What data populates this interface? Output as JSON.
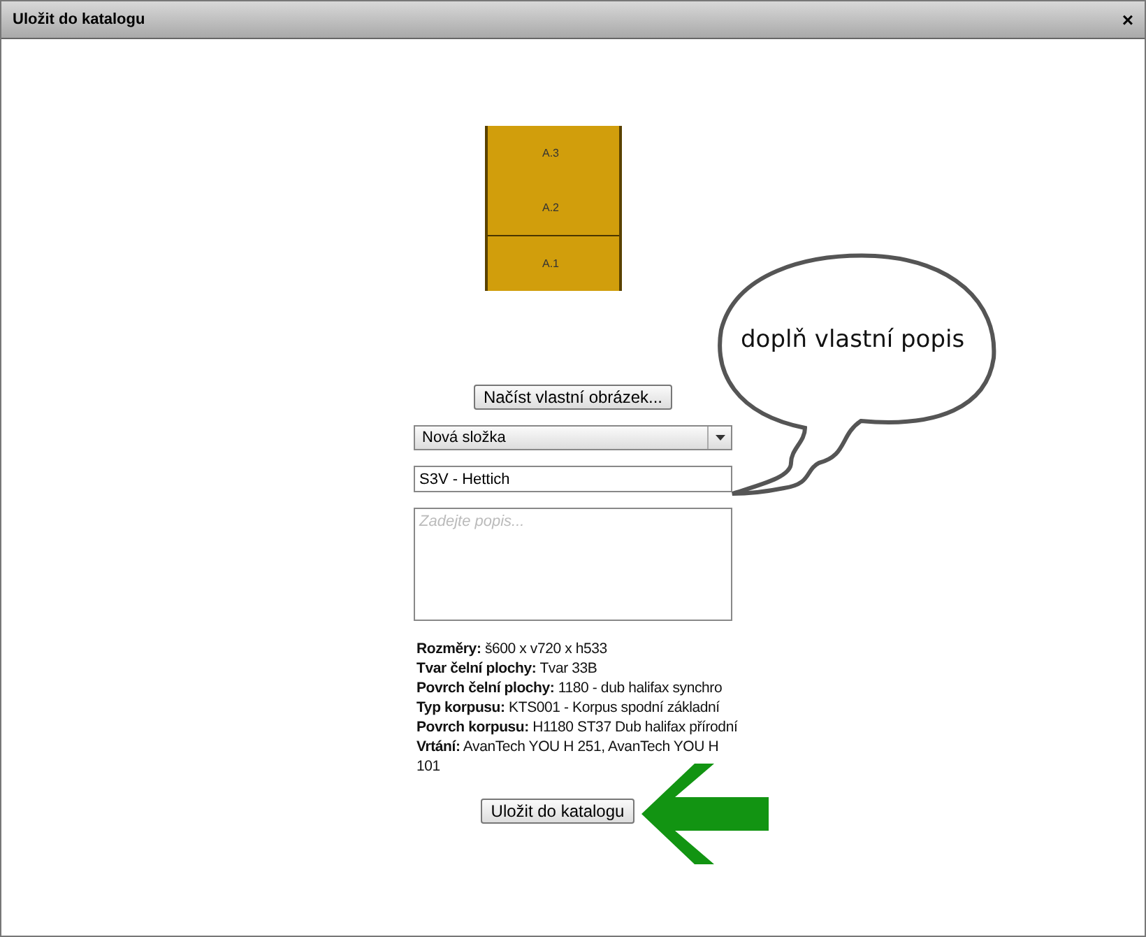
{
  "window": {
    "title": "Uložit do katalogu",
    "close": "×"
  },
  "preview": {
    "fronts": [
      {
        "labels": [
          "A.3",
          "A.2"
        ]
      },
      {
        "labels": [
          "A.1"
        ]
      }
    ]
  },
  "load_image_button": "Načíst vlastní obrázek...",
  "folder_select": {
    "value": "Nová složka"
  },
  "name_field": {
    "value": "S3V - Hettich"
  },
  "description_field": {
    "placeholder": "Zadejte popis..."
  },
  "details": [
    "**Rozměry:** š600 x v720 x h533",
    "**Tvar čelní plochy:** Tvar 33B",
    "**Povrch čelní plochy:** 1180 - dub halifax synchro",
    "**Typ korpusu:** KTS001 - Korpus spodní základní",
    "**Povrch korpusu:** H1180 ST37 Dub halifax přírodní",
    "**Vrtání:** AvanTech YOU H 251, AvanTech YOU H 101"
  ],
  "save_button": "Uložit do katalogu",
  "callout": {
    "text": "doplň vlastní popis"
  }
}
